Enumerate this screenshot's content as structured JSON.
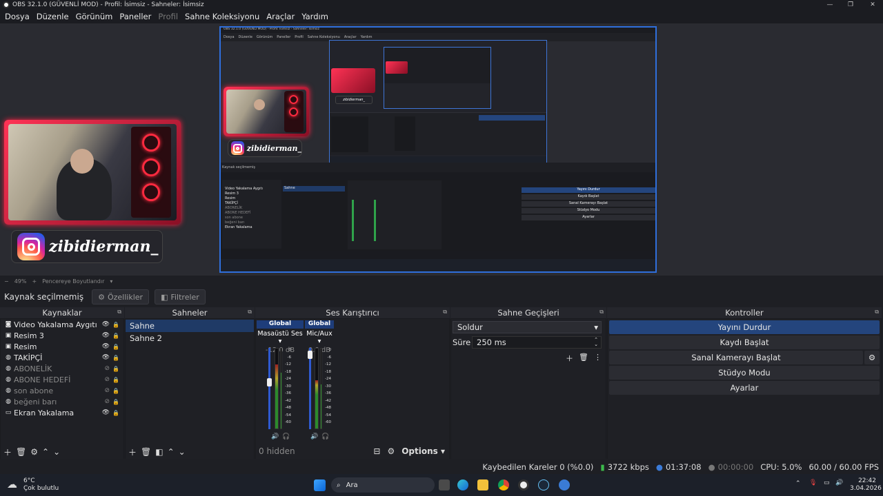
{
  "window": {
    "title": "OBS 32.1.0 (GÜVENLİ MOD) - Profil: İsimsiz - Sahneler: İsimsiz",
    "minimize": "—",
    "maximize": "❐",
    "close": "✕"
  },
  "menu": [
    "Dosya",
    "Düzenle",
    "Görünüm",
    "Paneller",
    "Profil",
    "Sahne Koleksiyonu",
    "Araçlar",
    "Yardım"
  ],
  "overlay": {
    "instagram_handle": "zibidierman_"
  },
  "zoom": {
    "minus": "−",
    "value": "49%",
    "plus": "+",
    "mode": "Pencereye Boyutlandır"
  },
  "source_bar": {
    "label": "Kaynak seçilmemiş",
    "properties": "Özellikler",
    "filters": "Filtreler"
  },
  "docks": {
    "sources": {
      "title": "Kaynaklar",
      "items": [
        {
          "name": "Video Yakalama Aygıtı",
          "icon": "camera-icon",
          "visible": true
        },
        {
          "name": "Resim 3",
          "icon": "image-icon",
          "visible": true
        },
        {
          "name": "Resim",
          "icon": "image-icon",
          "visible": true
        },
        {
          "name": "TAKİPÇİ",
          "icon": "globe-icon",
          "visible": true
        },
        {
          "name": "ABONELİK",
          "icon": "globe-icon",
          "visible": false
        },
        {
          "name": "ABONE HEDEFİ",
          "icon": "globe-icon",
          "visible": false
        },
        {
          "name": "son abone",
          "icon": "globe-icon",
          "visible": false
        },
        {
          "name": "beğeni barı",
          "icon": "globe-icon",
          "visible": false
        },
        {
          "name": "Ekran Yakalama",
          "icon": "monitor-icon",
          "visible": true
        }
      ]
    },
    "scenes": {
      "title": "Sahneler",
      "items": [
        {
          "name": "Sahne",
          "selected": true
        },
        {
          "name": "Sahne 2",
          "selected": false
        }
      ]
    },
    "mixer": {
      "title": "Ses Karıştırıcı",
      "channels": [
        {
          "tag": "Global",
          "name": "Masaüstü Ses",
          "db": "-12.0 dB",
          "level": 0.55
        },
        {
          "tag": "Global",
          "name": "Mic/Aux",
          "db": "0.0 dB",
          "level": 0.95
        }
      ],
      "scale": [
        "0",
        "-6",
        "-12",
        "-18",
        "-24",
        "-30",
        "-36",
        "-42",
        "-48",
        "-54",
        "-60"
      ],
      "hidden": "0 hidden",
      "options": "Options"
    },
    "transitions": {
      "title": "Sahne Geçişleri",
      "type": "Soldur",
      "duration_label": "Süre",
      "duration": "250 ms"
    },
    "controls": {
      "title": "Kontroller",
      "buttons": [
        "Yayını Durdur",
        "Kaydı Başlat",
        "Sanal Kamerayı Başlat",
        "Stüdyo Modu",
        "Ayarlar"
      ]
    }
  },
  "status": {
    "dropped": "Kaybedilen Kareler 0 (%0.0)",
    "bitrate": "3722 kbps",
    "stream_time": "01:37:08",
    "rec_time": "00:00:00",
    "cpu": "CPU: 5.0%",
    "fps": "60.00 / 60.00 FPS"
  },
  "taskbar": {
    "weather_temp": "6°C",
    "weather_desc": "Çok bulutlu",
    "search": "Ara",
    "time": "22:42",
    "date": "3.04.2026"
  }
}
